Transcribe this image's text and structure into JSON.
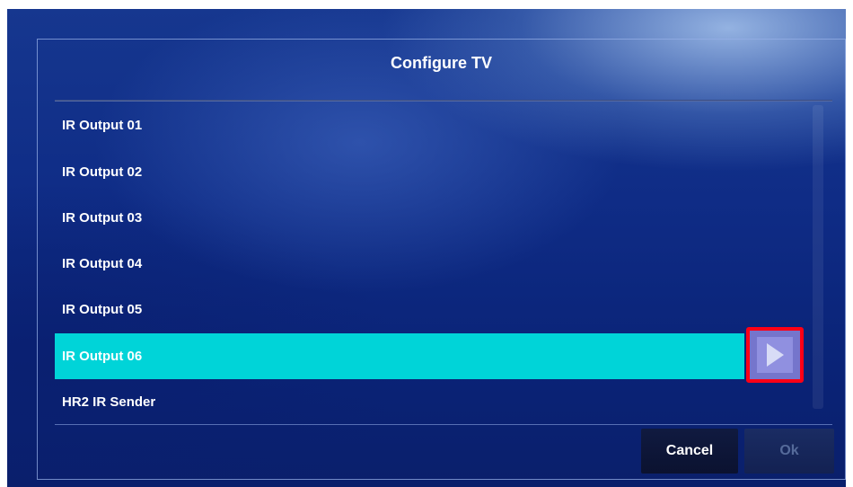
{
  "dialog": {
    "title": "Configure TV",
    "items": [
      {
        "label": "IR Output 01",
        "selected": false
      },
      {
        "label": "IR Output 02",
        "selected": false
      },
      {
        "label": "IR Output 03",
        "selected": false
      },
      {
        "label": "IR Output 04",
        "selected": false
      },
      {
        "label": "IR Output 05",
        "selected": false
      },
      {
        "label": "IR Output 06",
        "selected": true
      },
      {
        "label": "HR2 IR Sender",
        "selected": false
      }
    ],
    "selected_action_icon": "play-arrow-icon",
    "cancel_label": "Cancel",
    "ok_label": "Ok",
    "ok_enabled": false
  },
  "colors": {
    "selection": "#00d4d8",
    "highlight_border": "#ff0015",
    "background": "#0f2c86"
  }
}
